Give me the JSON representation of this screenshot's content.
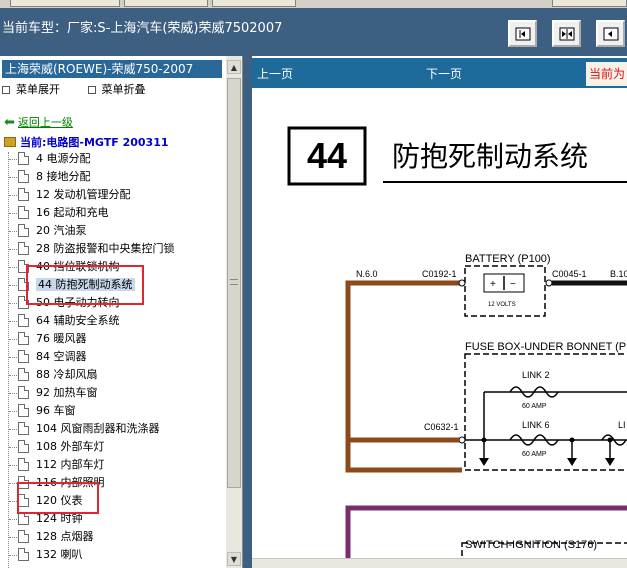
{
  "header": {
    "car_title": "当前车型：厂家:S-上海汽车(荣威)荣威7502007",
    "nav_buttons": [
      {
        "icon": "first-page-icon"
      },
      {
        "icon": "fit-page-icon"
      },
      {
        "icon": "prev-page-icon"
      }
    ]
  },
  "sidebar": {
    "title": "上海荣威(ROEWE)-荣威750-2007",
    "expand_label": "菜单展开",
    "collapse_label": "菜单折叠",
    "back_label": "返回上一级",
    "current_label": "当前:电路图-MGTF 200311",
    "items": [
      {
        "label": "4 电源分配"
      },
      {
        "label": "8 接地分配"
      },
      {
        "label": "12 发动机管理分配"
      },
      {
        "label": "16 起动和充电"
      },
      {
        "label": "20 汽油泵"
      },
      {
        "label": "28 防盗报警和中央集控门锁"
      },
      {
        "label": "40 挡位联锁机构"
      },
      {
        "label": "44 防抱死制动系统"
      },
      {
        "label": "50 电子动力转向"
      },
      {
        "label": "64 辅助安全系统"
      },
      {
        "label": "76 暖风器"
      },
      {
        "label": "84 空调器"
      },
      {
        "label": "88 冷却风扇"
      },
      {
        "label": "92 加热车窗"
      },
      {
        "label": "96 车窗"
      },
      {
        "label": "104 风窗雨刮器和洗涤器"
      },
      {
        "label": "108 外部车灯"
      },
      {
        "label": "112 内部车灯"
      },
      {
        "label": "116 内部照明"
      },
      {
        "label": "120 仪表"
      },
      {
        "label": "124 时钟"
      },
      {
        "label": "128 点烟器"
      },
      {
        "label": "132 喇叭"
      }
    ],
    "selected_index": 7
  },
  "viewer": {
    "prev_label": "上一页",
    "next_label": "下一页",
    "current_label": "当前为",
    "page_number": "44",
    "page_title": "防抱死制动系统",
    "labels": {
      "battery": "BATTERY (P100)",
      "n6": "N.6.0",
      "c0192": "C0192-1",
      "c0045": "C0045-1",
      "b10": "B.10",
      "volts": "12 VOLTS",
      "fuse_box": "FUSE BOX-UNDER BONNET (P",
      "link2": "LINK 2",
      "amp60a": "60 AMP",
      "link6": "LINK 6",
      "amp60b": "60 AMP",
      "li": "LI",
      "c0632": "C0632-1",
      "switch": "SWITCH-IGNITION (S176)"
    },
    "colors": {
      "brown_wire": "#8b4a1c",
      "purple_wire": "#7a2d6e",
      "black_wire": "#111111"
    }
  },
  "annotations": {
    "highlight_color": "#e0272f"
  }
}
